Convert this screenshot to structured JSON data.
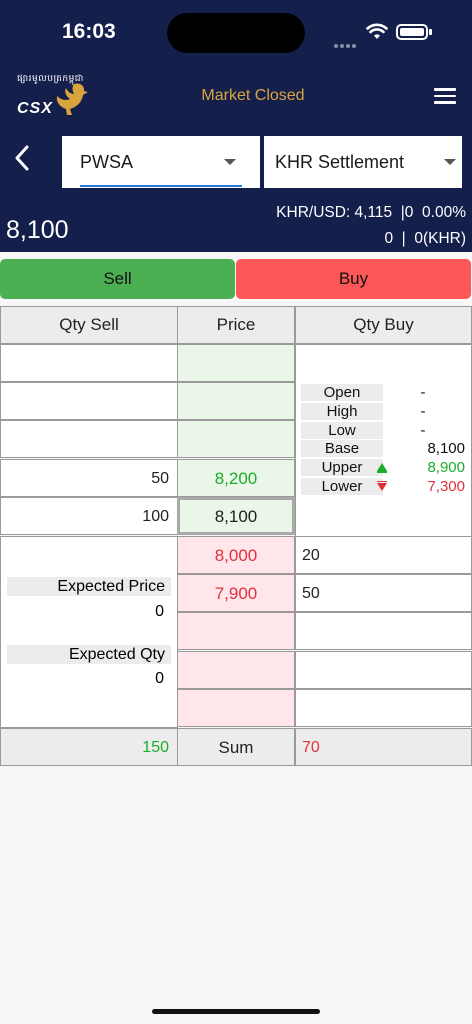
{
  "status_bar": {
    "time": "16:03"
  },
  "header": {
    "logo_khmer": "ផ្សារមូលបត្រកម្ពុជា",
    "logo_abbr": "CSX",
    "market_status": "Market Closed",
    "status_color": "#d9a43b"
  },
  "selectors": {
    "symbol": "PWSA",
    "settlement": "KHR Settlement"
  },
  "quote": {
    "last_price": "8,100",
    "fx": "KHR/USD: 4,115  |0  0.00%",
    "change": "0  |  0(KHR)"
  },
  "actions": {
    "sell": "Sell",
    "buy": "Buy"
  },
  "order_book": {
    "headers": {
      "qty_sell": "Qty Sell",
      "price": "Price",
      "qty_buy": "Qty Buy"
    },
    "asks": [
      {
        "qty": "",
        "price": ""
      },
      {
        "qty": "",
        "price": ""
      },
      {
        "qty": "",
        "price": ""
      },
      {
        "qty": "50",
        "price": "8,200"
      },
      {
        "qty": "100",
        "price": "8,100"
      }
    ],
    "bids": [
      {
        "price": "8,000",
        "qty": "20"
      },
      {
        "price": "7,900",
        "qty": "50"
      },
      {
        "price": "",
        "qty": ""
      },
      {
        "price": "",
        "qty": ""
      },
      {
        "price": "",
        "qty": ""
      }
    ],
    "summary": {
      "open_label": "Open",
      "open": "-",
      "high_label": "High",
      "high": "-",
      "low_label": "Low",
      "low": "-",
      "base_label": "Base",
      "base": "8,100",
      "upper_label": "Upper",
      "upper": "8,900",
      "lower_label": "Lower",
      "lower": "7,300"
    },
    "expected": {
      "price_label": "Expected Price",
      "price": "0",
      "qty_label": "Expected Qty",
      "qty": "0"
    },
    "totals": {
      "sell": "150",
      "label": "Sum",
      "buy": "70"
    }
  }
}
